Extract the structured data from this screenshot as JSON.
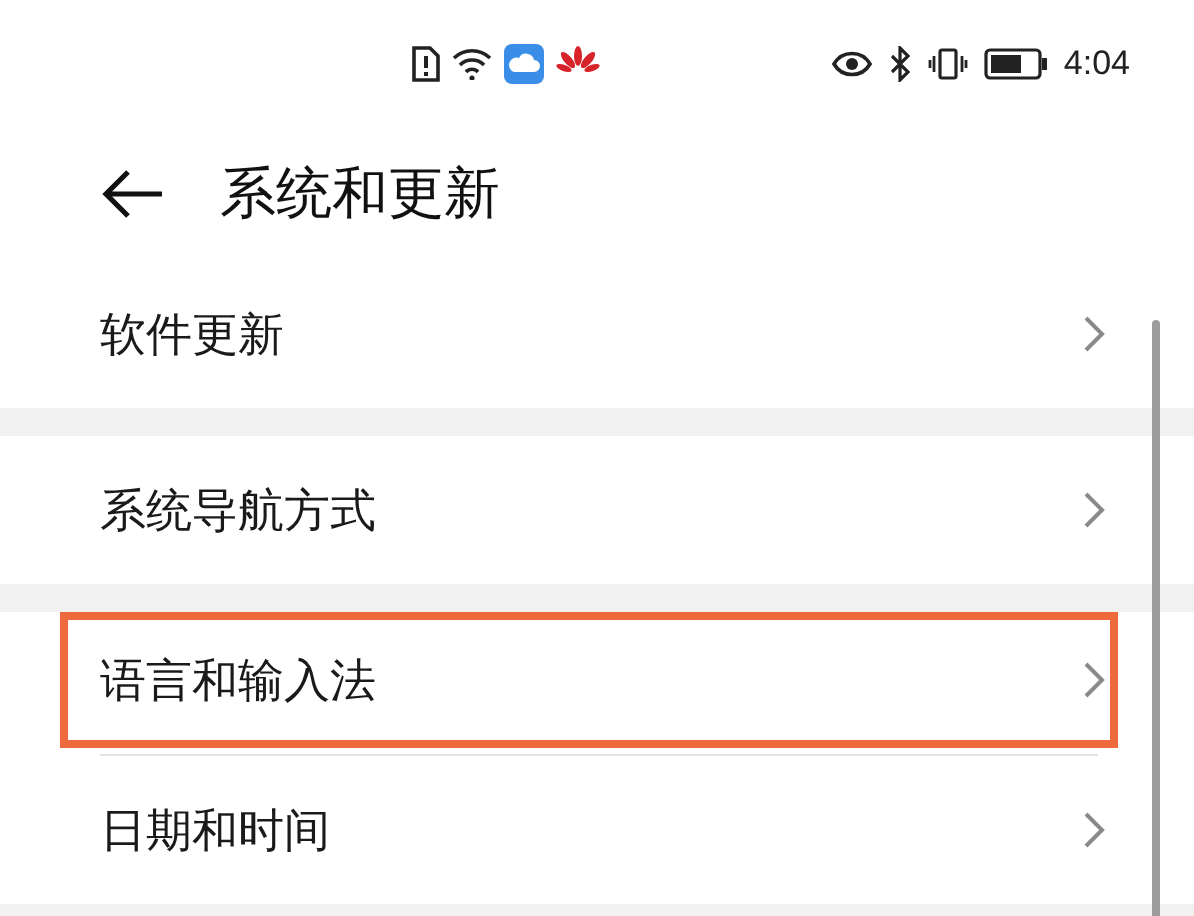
{
  "status_bar": {
    "time": "4:04"
  },
  "header": {
    "title": "系统和更新"
  },
  "groups": [
    {
      "items": [
        {
          "label": "软件更新",
          "highlighted": false
        }
      ]
    },
    {
      "items": [
        {
          "label": "系统导航方式",
          "highlighted": false
        }
      ]
    },
    {
      "items": [
        {
          "label": "语言和输入法",
          "highlighted": true
        },
        {
          "label": "日期和时间",
          "highlighted": false
        }
      ]
    }
  ]
}
